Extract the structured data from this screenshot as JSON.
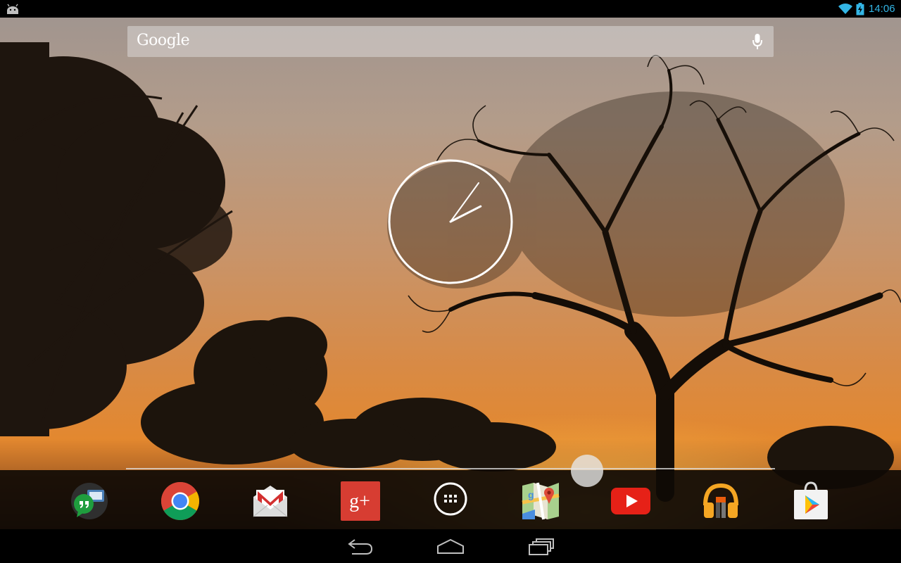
{
  "status_bar": {
    "time": "14:06",
    "left_icon": "android-debug-icon",
    "right_icons": [
      "wifi-icon",
      "battery-charging-icon"
    ],
    "accent_color": "#33b5e5"
  },
  "search_bar": {
    "logo_text": "Google",
    "mic_icon": "microphone-icon"
  },
  "clock": {
    "type": "analog",
    "hour": 14,
    "minute": 6
  },
  "dock": {
    "apps": [
      {
        "name": "Hangouts",
        "icon": "hangouts-icon"
      },
      {
        "name": "Chrome",
        "icon": "chrome-icon"
      },
      {
        "name": "Gmail",
        "icon": "gmail-icon"
      },
      {
        "name": "Google+",
        "icon": "google-plus-icon",
        "label": "g+"
      },
      {
        "name": "Apps",
        "icon": "all-apps-icon"
      },
      {
        "name": "Maps",
        "icon": "maps-icon"
      },
      {
        "name": "YouTube",
        "icon": "youtube-icon"
      },
      {
        "name": "Play Music",
        "icon": "play-music-icon"
      },
      {
        "name": "Play Store",
        "icon": "play-store-icon"
      }
    ]
  },
  "nav_bar": {
    "buttons": [
      "back-icon",
      "home-icon",
      "recents-icon"
    ]
  },
  "wallpaper": {
    "theme": "savanna sunset with silhouetted trees",
    "colors": [
      "#a89a8f",
      "#c98a50",
      "#e6902c"
    ]
  }
}
